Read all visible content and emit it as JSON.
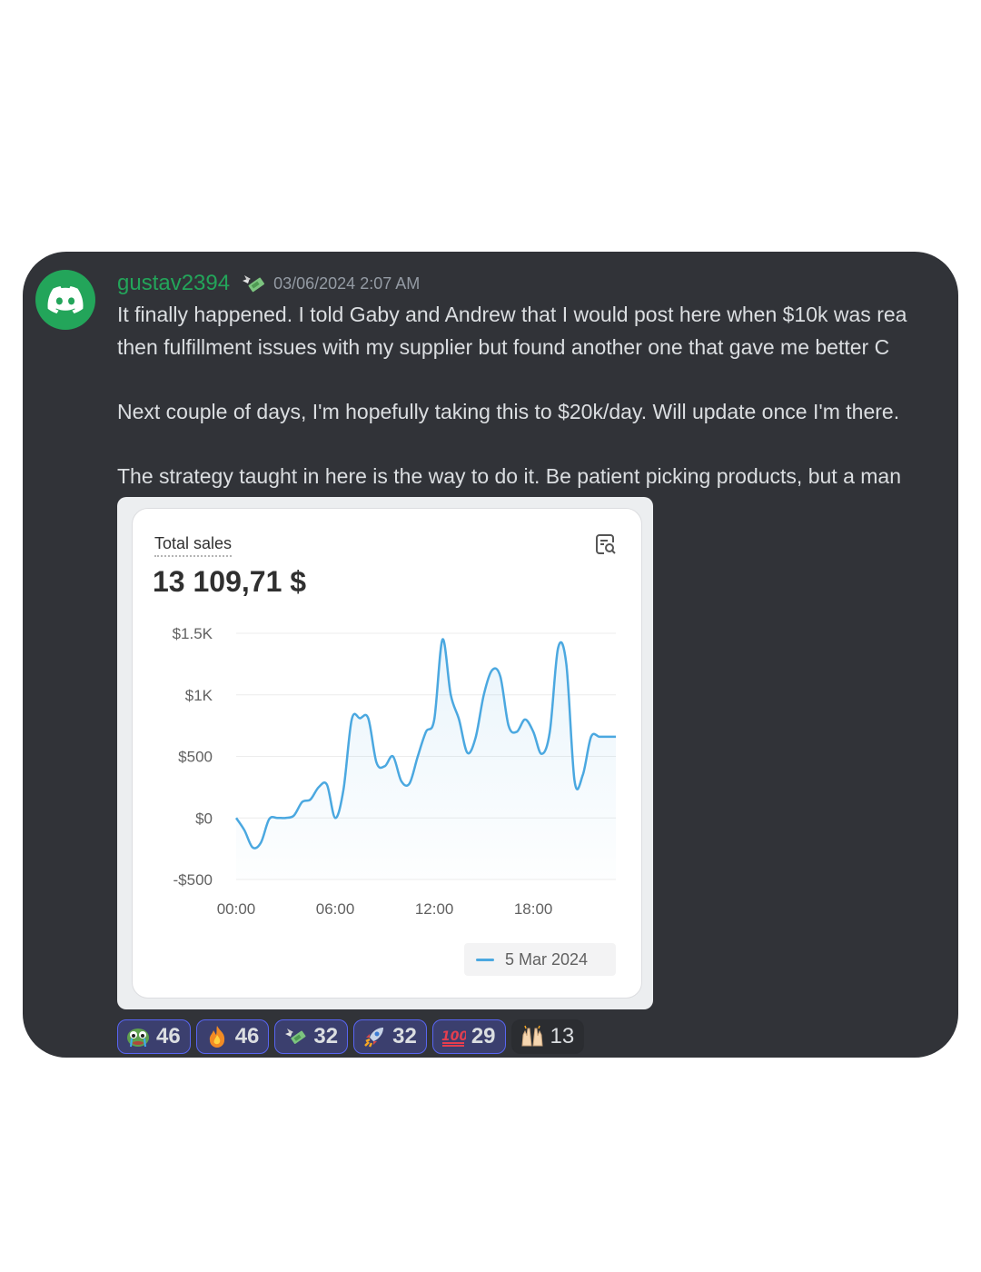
{
  "message": {
    "username": "gustav2394",
    "timestamp": "03/06/2024 2:07 AM",
    "lines": [
      "It finally happened. I told Gaby and Andrew that I would post here when $10k was rea",
      "then fulfillment issues with my supplier but found another one that gave me better C",
      "",
      "Next couple of days, I'm hopefully taking this to $20k/day. Will update once I'm there.",
      "",
      "The strategy taught in here is the way to do it. Be patient picking products, but a man"
    ]
  },
  "sales_card": {
    "title": "Total sales",
    "total": "13 109,71 $",
    "legend_label": "5 Mar 2024"
  },
  "chart_data": {
    "type": "line",
    "title": "Total sales",
    "xlabel": "",
    "ylabel": "",
    "x_ticks": [
      "00:00",
      "06:00",
      "12:00",
      "18:00"
    ],
    "y_ticks": [
      "$1.5K",
      "$1K",
      "$500",
      "$0",
      "-$500"
    ],
    "y_tick_values": [
      1500,
      1000,
      500,
      0,
      -500
    ],
    "xlim": [
      0,
      23
    ],
    "ylim": [
      -500,
      1500
    ],
    "grid": true,
    "legend_position": "bottom-right",
    "series": [
      {
        "name": "5 Mar 2024",
        "color": "#4ba8e0",
        "x": [
          0,
          0.5,
          1,
          1.5,
          2,
          2.5,
          3,
          3.5,
          4,
          4.5,
          5,
          5.5,
          6,
          6.5,
          7,
          7.5,
          8,
          8.5,
          9,
          9.5,
          10,
          10.5,
          11,
          11.5,
          12,
          12.5,
          13,
          13.5,
          14,
          14.5,
          15,
          15.5,
          16,
          16.5,
          17,
          17.5,
          18,
          18.5,
          19,
          19.5,
          20,
          20.5,
          21,
          21.5,
          22,
          22.5,
          23
        ],
        "values": [
          0,
          -100,
          -240,
          -200,
          -10,
          0,
          0,
          20,
          130,
          150,
          250,
          270,
          0,
          230,
          800,
          810,
          810,
          450,
          420,
          500,
          300,
          280,
          500,
          700,
          800,
          1450,
          1000,
          800,
          530,
          650,
          1000,
          1200,
          1150,
          750,
          700,
          800,
          700,
          520,
          700,
          1380,
          1250,
          300,
          350,
          660,
          660,
          660,
          660
        ]
      }
    ]
  },
  "reactions": [
    {
      "emoji": "pepe-cry-icon",
      "count": "46",
      "active": true
    },
    {
      "emoji": "fire-icon",
      "count": "46",
      "active": true
    },
    {
      "emoji": "money-wings-icon",
      "count": "32",
      "active": true
    },
    {
      "emoji": "rocket-icon",
      "count": "32",
      "active": true
    },
    {
      "emoji": "hundred-points-icon",
      "count": "29",
      "active": true
    },
    {
      "emoji": "raising-hands-icon",
      "count": "13",
      "active": false
    }
  ]
}
